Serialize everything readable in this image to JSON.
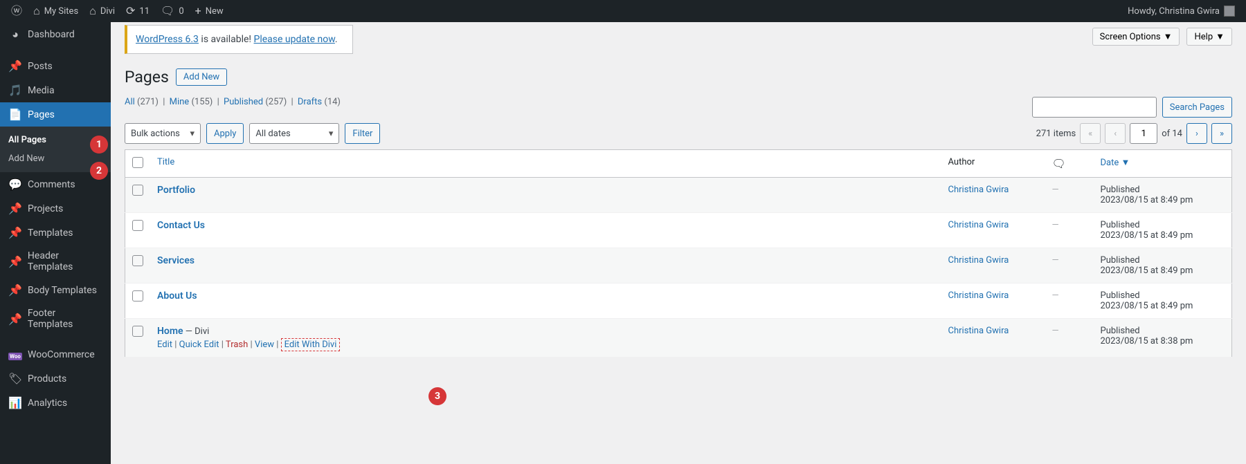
{
  "adminbar": {
    "my_sites": "My Sites",
    "site_name": "Divi",
    "updates": "11",
    "comments": "0",
    "new": "New",
    "howdy": "Howdy, Christina Gwira"
  },
  "sidebar": {
    "items": [
      {
        "icon": "⌼",
        "label": "Dashboard"
      },
      {
        "icon": "📌",
        "label": "Posts"
      },
      {
        "icon": "🎵",
        "label": "Media"
      },
      {
        "icon": "📄",
        "label": "Pages",
        "current": true
      },
      {
        "icon": "💬",
        "label": "Comments"
      },
      {
        "icon": "📌",
        "label": "Projects"
      },
      {
        "icon": "📌",
        "label": "Templates"
      },
      {
        "icon": "📌",
        "label": "Header Templates"
      },
      {
        "icon": "📌",
        "label": "Body Templates"
      },
      {
        "icon": "📌",
        "label": "Footer Templates"
      },
      {
        "icon": "wc",
        "label": "WooCommerce"
      },
      {
        "icon": "🏷",
        "label": "Products"
      },
      {
        "icon": "📊",
        "label": "Analytics"
      }
    ],
    "submenu": [
      {
        "label": "All Pages",
        "current": true
      },
      {
        "label": "Add New"
      }
    ]
  },
  "top_buttons": {
    "screen_options": "Screen Options",
    "help": "Help"
  },
  "notice": {
    "wp": "WordPress 6.3",
    "avail": " is available! ",
    "update": "Please update now",
    "dot": "."
  },
  "heading": "Pages",
  "add_new": "Add New",
  "filters": {
    "all": "All",
    "all_count": "(271)",
    "mine": "Mine",
    "mine_count": "(155)",
    "published": "Published",
    "published_count": "(257)",
    "drafts": "Drafts",
    "drafts_count": "(14)"
  },
  "search_btn": "Search Pages",
  "bulk": {
    "actions": "Bulk actions",
    "apply": "Apply",
    "all_dates": "All dates",
    "filter": "Filter"
  },
  "pagination": {
    "total": "271 items",
    "page": "1",
    "of": "of 14"
  },
  "columns": {
    "title": "Title",
    "author": "Author",
    "date": "Date"
  },
  "rows": [
    {
      "title": "Portfolio",
      "author": "Christina Gwira",
      "status": "Published",
      "date": "2023/08/15 at 8:49 pm"
    },
    {
      "title": "Contact Us",
      "author": "Christina Gwira",
      "status": "Published",
      "date": "2023/08/15 at 8:49 pm"
    },
    {
      "title": "Services",
      "author": "Christina Gwira",
      "status": "Published",
      "date": "2023/08/15 at 8:49 pm"
    },
    {
      "title": "About Us",
      "author": "Christina Gwira",
      "status": "Published",
      "date": "2023/08/15 at 8:49 pm"
    },
    {
      "title": "Home",
      "suffix": " — Divi",
      "author": "Christina Gwira",
      "status": "Published",
      "date": "2023/08/15 at 8:38 pm",
      "row_actions": true
    }
  ],
  "row_actions": {
    "edit": "Edit",
    "quick": "Quick Edit",
    "trash": "Trash",
    "view": "View",
    "divi": "Edit With Divi"
  },
  "annotations": {
    "1": "1",
    "2": "2",
    "3": "3"
  }
}
